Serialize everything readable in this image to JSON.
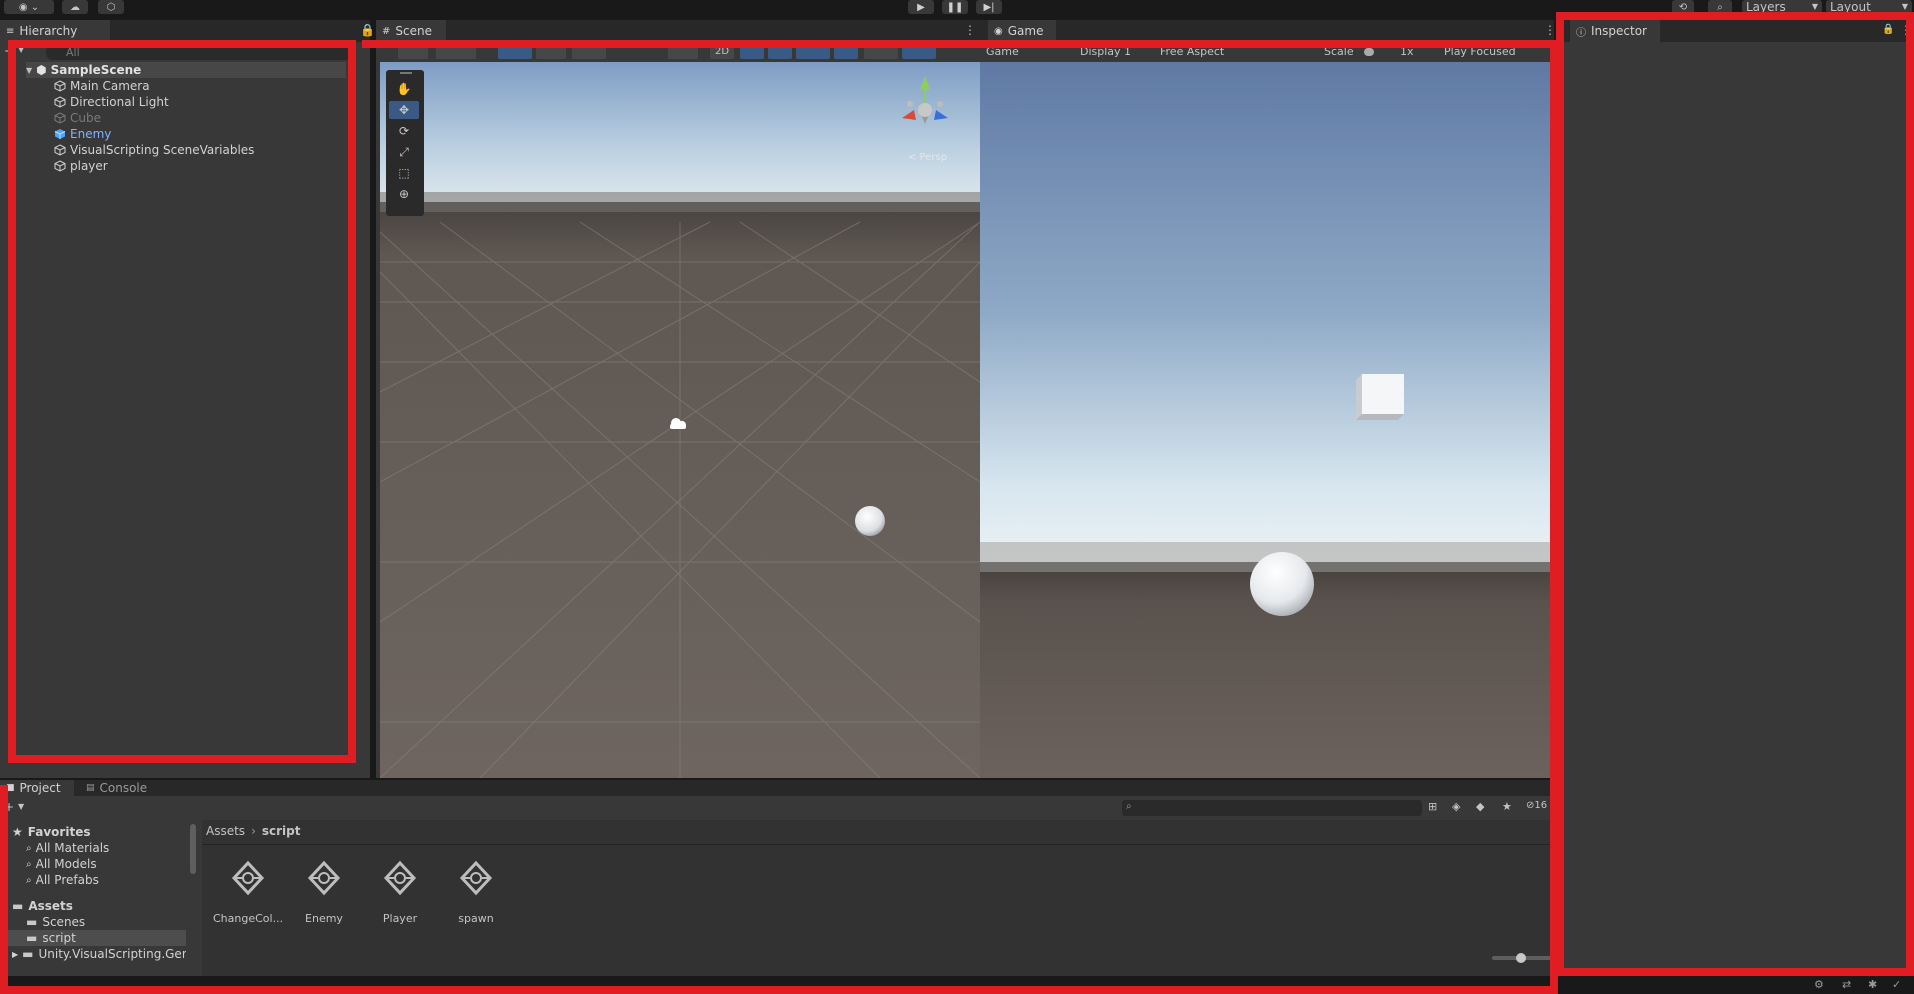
{
  "toolbar": {
    "layers_label": "Layers",
    "layout_label": "Layout"
  },
  "hierarchy": {
    "tab_label": "Hierarchy",
    "search_placeholder": "All",
    "scene_name": "SampleScene",
    "items": [
      {
        "label": "Main Camera",
        "state": "normal"
      },
      {
        "label": "Directional Light",
        "state": "normal"
      },
      {
        "label": "Cube",
        "state": "disabled"
      },
      {
        "label": "Enemy",
        "state": "prefab"
      },
      {
        "label": "VisualScripting SceneVariables",
        "state": "normal"
      },
      {
        "label": "player",
        "state": "normal"
      }
    ]
  },
  "scene": {
    "tab_label": "Scene",
    "mode_2d": "2D",
    "persp_label": "< Persp",
    "tools": [
      "hand-tool",
      "move-tool",
      "rotate-tool",
      "scale-tool",
      "rect-tool",
      "transform-tool"
    ]
  },
  "game": {
    "tab_label": "Game",
    "toolbar": {
      "game_label": "Game",
      "display_label": "Display 1",
      "aspect_label": "Free Aspect",
      "scale_label": "Scale",
      "scale_value": "1x",
      "play_focused_label": "Play Focused"
    }
  },
  "inspector": {
    "tab_label": "Inspector"
  },
  "project": {
    "tabs": [
      {
        "label": "Project",
        "active": true
      },
      {
        "label": "Console",
        "active": false
      }
    ],
    "favorites_label": "Favorites",
    "favorites": [
      "All Materials",
      "All Models",
      "All Prefabs"
    ],
    "assets_label": "Assets",
    "folders": [
      "Scenes",
      "script",
      "Unity.VisualScripting.Gen..."
    ],
    "breadcrumb": [
      "Assets",
      "script"
    ],
    "assets": [
      {
        "name": "ChangeCol..."
      },
      {
        "name": "Enemy"
      },
      {
        "name": "Player"
      },
      {
        "name": "spawn"
      }
    ],
    "hidden_count": "16"
  },
  "colors": {
    "highlight": "#e11d24",
    "panel_bg": "#383838",
    "prefab_blue": "#7fb2ff"
  }
}
